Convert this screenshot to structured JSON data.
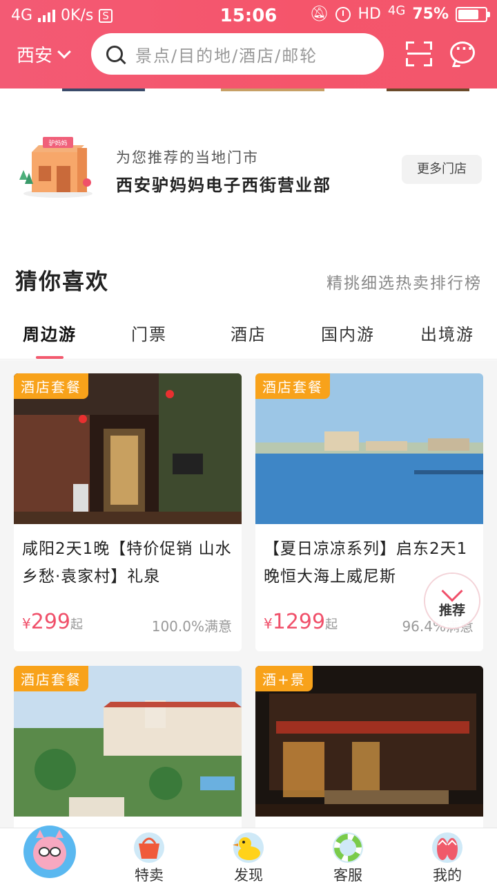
{
  "status_bar": {
    "network": "4G",
    "speed": "0K/s",
    "s_badge": "S",
    "time": "15:06",
    "hd": "HD",
    "net2": "4G",
    "battery": "75%",
    "battery_level": 0.75
  },
  "header": {
    "city": "西安",
    "search_placeholder": "景点/目的地/酒店/邮轮",
    "accent_color": "#f35a6e"
  },
  "store": {
    "subtitle": "为您推荐的当地门市",
    "name": "西安驴妈妈电子西街营业部",
    "more_label": "更多门店",
    "sign": "驴妈妈"
  },
  "guess": {
    "title": "猜你喜欢",
    "rank_link": "精挑细选热卖排行榜",
    "tabs": [
      "周边游",
      "门票",
      "酒店",
      "国内游",
      "出境游"
    ],
    "active_tab": 0
  },
  "products": [
    {
      "tag": "酒店套餐",
      "title": "咸阳2天1晚【特价促销 山水乡愁·袁家村】礼泉",
      "currency": "¥",
      "price": "299",
      "suffix": "起",
      "satisfaction": "100.0%满意"
    },
    {
      "tag": "酒店套餐",
      "title": "【夏日凉凉系列】启东2天1晚恒大海上威尼斯",
      "currency": "¥",
      "price": "1299",
      "suffix": "起",
      "satisfaction": "96.4%满意"
    },
    {
      "tag": "酒店套餐",
      "title": "",
      "currency": "",
      "price": "",
      "suffix": "",
      "satisfaction": ""
    },
    {
      "tag": "酒+景",
      "title": "",
      "currency": "",
      "price": "",
      "suffix": "",
      "satisfaction": ""
    }
  ],
  "recommend_button": "推荐",
  "bottom_nav": [
    {
      "label": "",
      "icon": "mascot-icon"
    },
    {
      "label": "特卖",
      "icon": "shopping-basket-icon"
    },
    {
      "label": "发现",
      "icon": "duck-icon"
    },
    {
      "label": "客服",
      "icon": "lifebuoy-icon"
    },
    {
      "label": "我的",
      "icon": "flip-flops-icon"
    }
  ]
}
